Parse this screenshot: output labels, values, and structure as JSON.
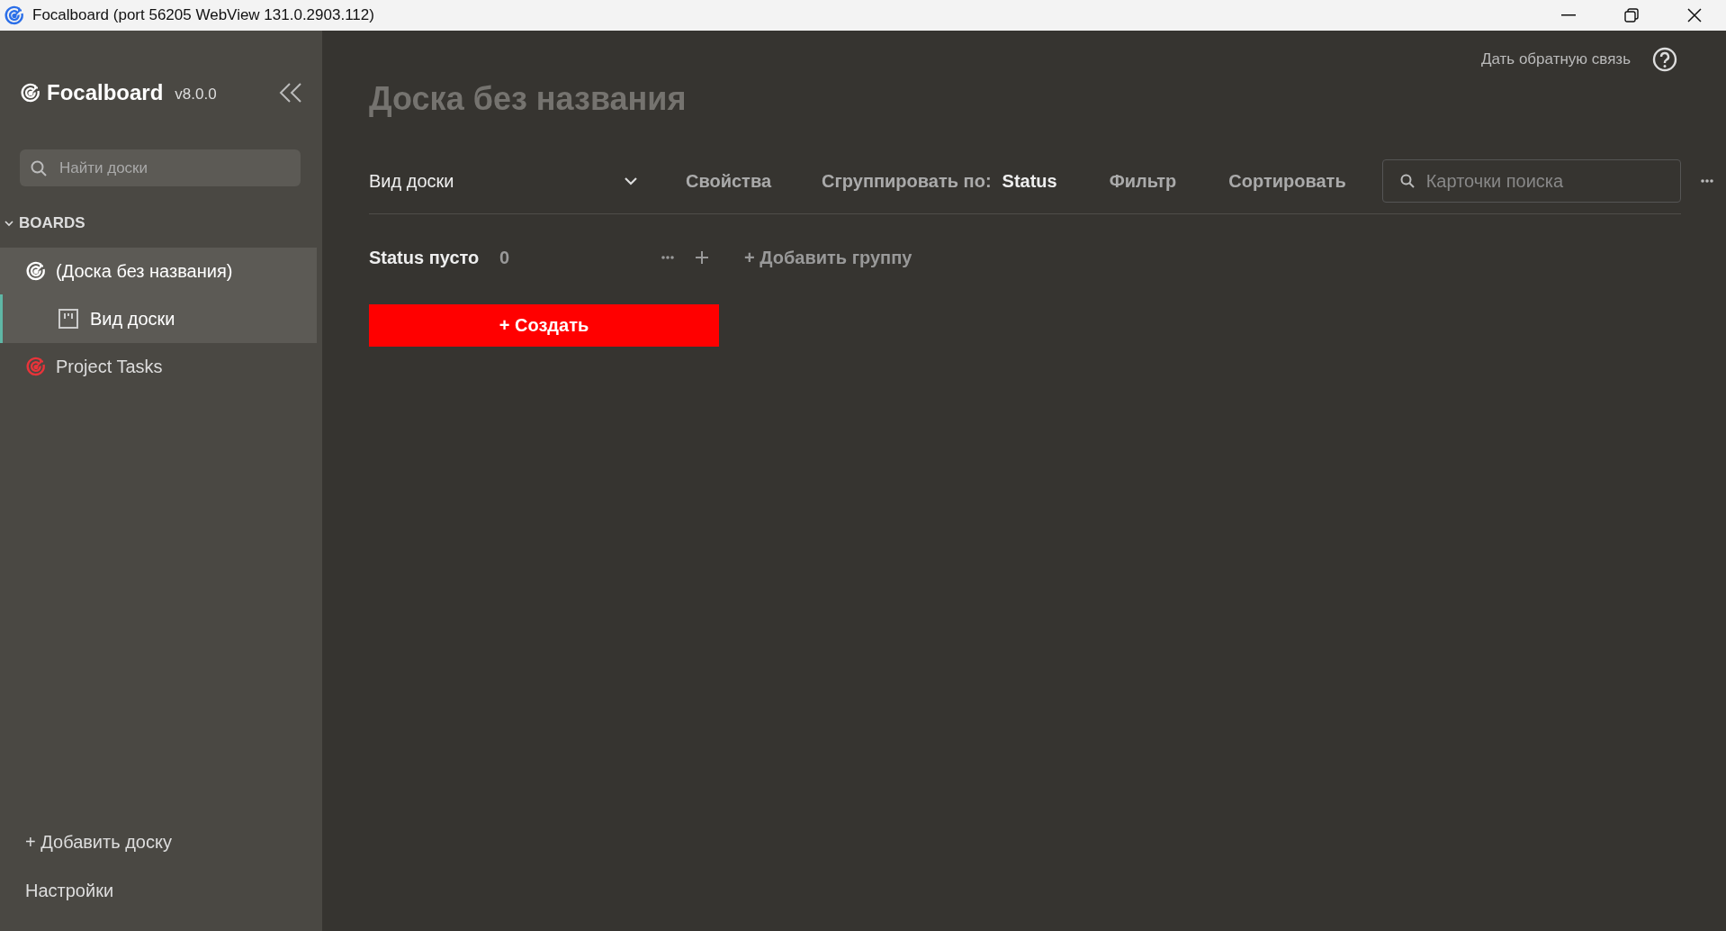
{
  "window": {
    "title": "Focalboard (port 56205 WebView 131.0.2903.112)"
  },
  "sidebar": {
    "logo": {
      "name": "Focalboard",
      "version": "v8.0.0"
    },
    "search": {
      "placeholder": "Найти доски"
    },
    "section": {
      "label": "BOARDS",
      "expanded": true
    },
    "boards": [
      {
        "title": "(Доска без названия)",
        "color": "#ffffff",
        "selected": true,
        "children": [
          {
            "title": "Вид доски",
            "selected": true
          }
        ]
      },
      {
        "title": "Project Tasks",
        "color": "#e8343a",
        "selected": false
      }
    ],
    "add_board": "+ Добавить доску",
    "settings": "Настройки"
  },
  "main": {
    "feedback": "Дать обратную связь",
    "title": "Доска без названия",
    "toolbar": {
      "view": "Вид доски",
      "properties": "Свойства",
      "group_by": {
        "label": "Сгруппировать по:",
        "value": "Status"
      },
      "filter": "Фильтр",
      "sort": "Сортировать",
      "search": {
        "placeholder": "Карточки поиска"
      }
    },
    "group": {
      "title": "Status пусто",
      "count": "0"
    },
    "add_group": "+ Добавить группу",
    "create_button": "+ Создать"
  }
}
